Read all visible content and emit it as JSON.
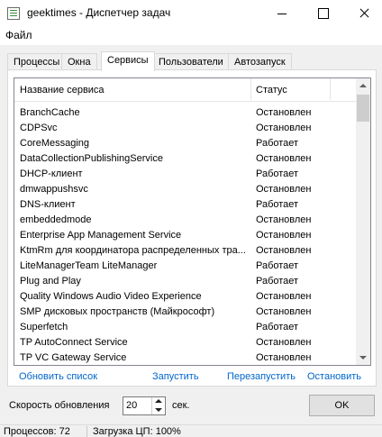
{
  "window": {
    "title": "geektimes - Диспетчер задач"
  },
  "menu": {
    "items": [
      "Файл"
    ]
  },
  "tabs": [
    "Процессы",
    "Окна",
    "Сервисы",
    "Пользователи",
    "Автозапуск"
  ],
  "active_tab": "Сервисы",
  "services": {
    "columns": {
      "name": "Название сервиса",
      "status": "Статус"
    },
    "rows": [
      {
        "name": "BranchCache",
        "status": "Остановлен"
      },
      {
        "name": "CDPSvc",
        "status": "Остановлен"
      },
      {
        "name": "CoreMessaging",
        "status": "Работает"
      },
      {
        "name": "DataCollectionPublishingService",
        "status": "Остановлен"
      },
      {
        "name": "DHCP-клиент",
        "status": "Работает"
      },
      {
        "name": "dmwappushsvc",
        "status": "Остановлен"
      },
      {
        "name": "DNS-клиент",
        "status": "Работает"
      },
      {
        "name": "embeddedmode",
        "status": "Остановлен"
      },
      {
        "name": "Enterprise App Management Service",
        "status": "Остановлен"
      },
      {
        "name": "KtmRm для координатора распределенных тра...",
        "status": "Остановлен"
      },
      {
        "name": "LiteManagerTeam LiteManager",
        "status": "Работает"
      },
      {
        "name": "Plug and Play",
        "status": "Работает"
      },
      {
        "name": "Quality Windows Audio Video Experience",
        "status": "Остановлен"
      },
      {
        "name": "SMP дисковых пространств (Майкрософт)",
        "status": "Остановлен"
      },
      {
        "name": "Superfetch",
        "status": "Работает"
      },
      {
        "name": "TP AutoConnect Service",
        "status": "Остановлен"
      },
      {
        "name": "TP VC Gateway Service",
        "status": "Остановлен"
      }
    ]
  },
  "actions": {
    "refresh_list": "Обновить список",
    "start": "Запустить",
    "restart": "Перезапустить",
    "stop": "Остановить"
  },
  "refresh": {
    "label": "Скорость обновления",
    "value": "20",
    "unit": "сек."
  },
  "ok_label": "OK",
  "statusbar": {
    "processes": "Процессов: 72",
    "cpu": "Загрузка ЦП: 100%"
  },
  "colors": {
    "link": "#0066cc",
    "window_bg": "#f0f0f0"
  }
}
